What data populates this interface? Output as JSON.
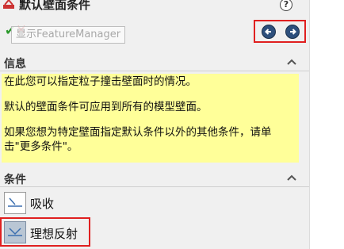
{
  "header": {
    "title": "默认壁面条件",
    "help_label": "?",
    "icon": "boundary-condition-icon"
  },
  "actions": {
    "ok_label": "✔",
    "cancel_label": "✕",
    "tooltip": "显示FeatureManager",
    "back_icon": "arrow-left-icon",
    "forward_icon": "arrow-right-icon"
  },
  "sections": {
    "info": {
      "title": "信息",
      "lines": [
        "在此您可以指定粒子撞击壁面时的情况。",
        "默认的壁面条件可应用到所有的模型壁面。",
        "如果您想为特定壁面指定默认条件以外的其他条件，请单击\"更多条件\"。"
      ]
    },
    "conditions": {
      "title": "条件",
      "items": [
        {
          "label": "吸收",
          "icon": "absorb-icon",
          "selected": false
        },
        {
          "label": "理想反射",
          "icon": "ideal-reflection-icon",
          "selected": true
        }
      ]
    }
  },
  "colors": {
    "info_bg": "#ffff99",
    "highlight": "#e02020",
    "nav_button": "#2d4f7c"
  }
}
